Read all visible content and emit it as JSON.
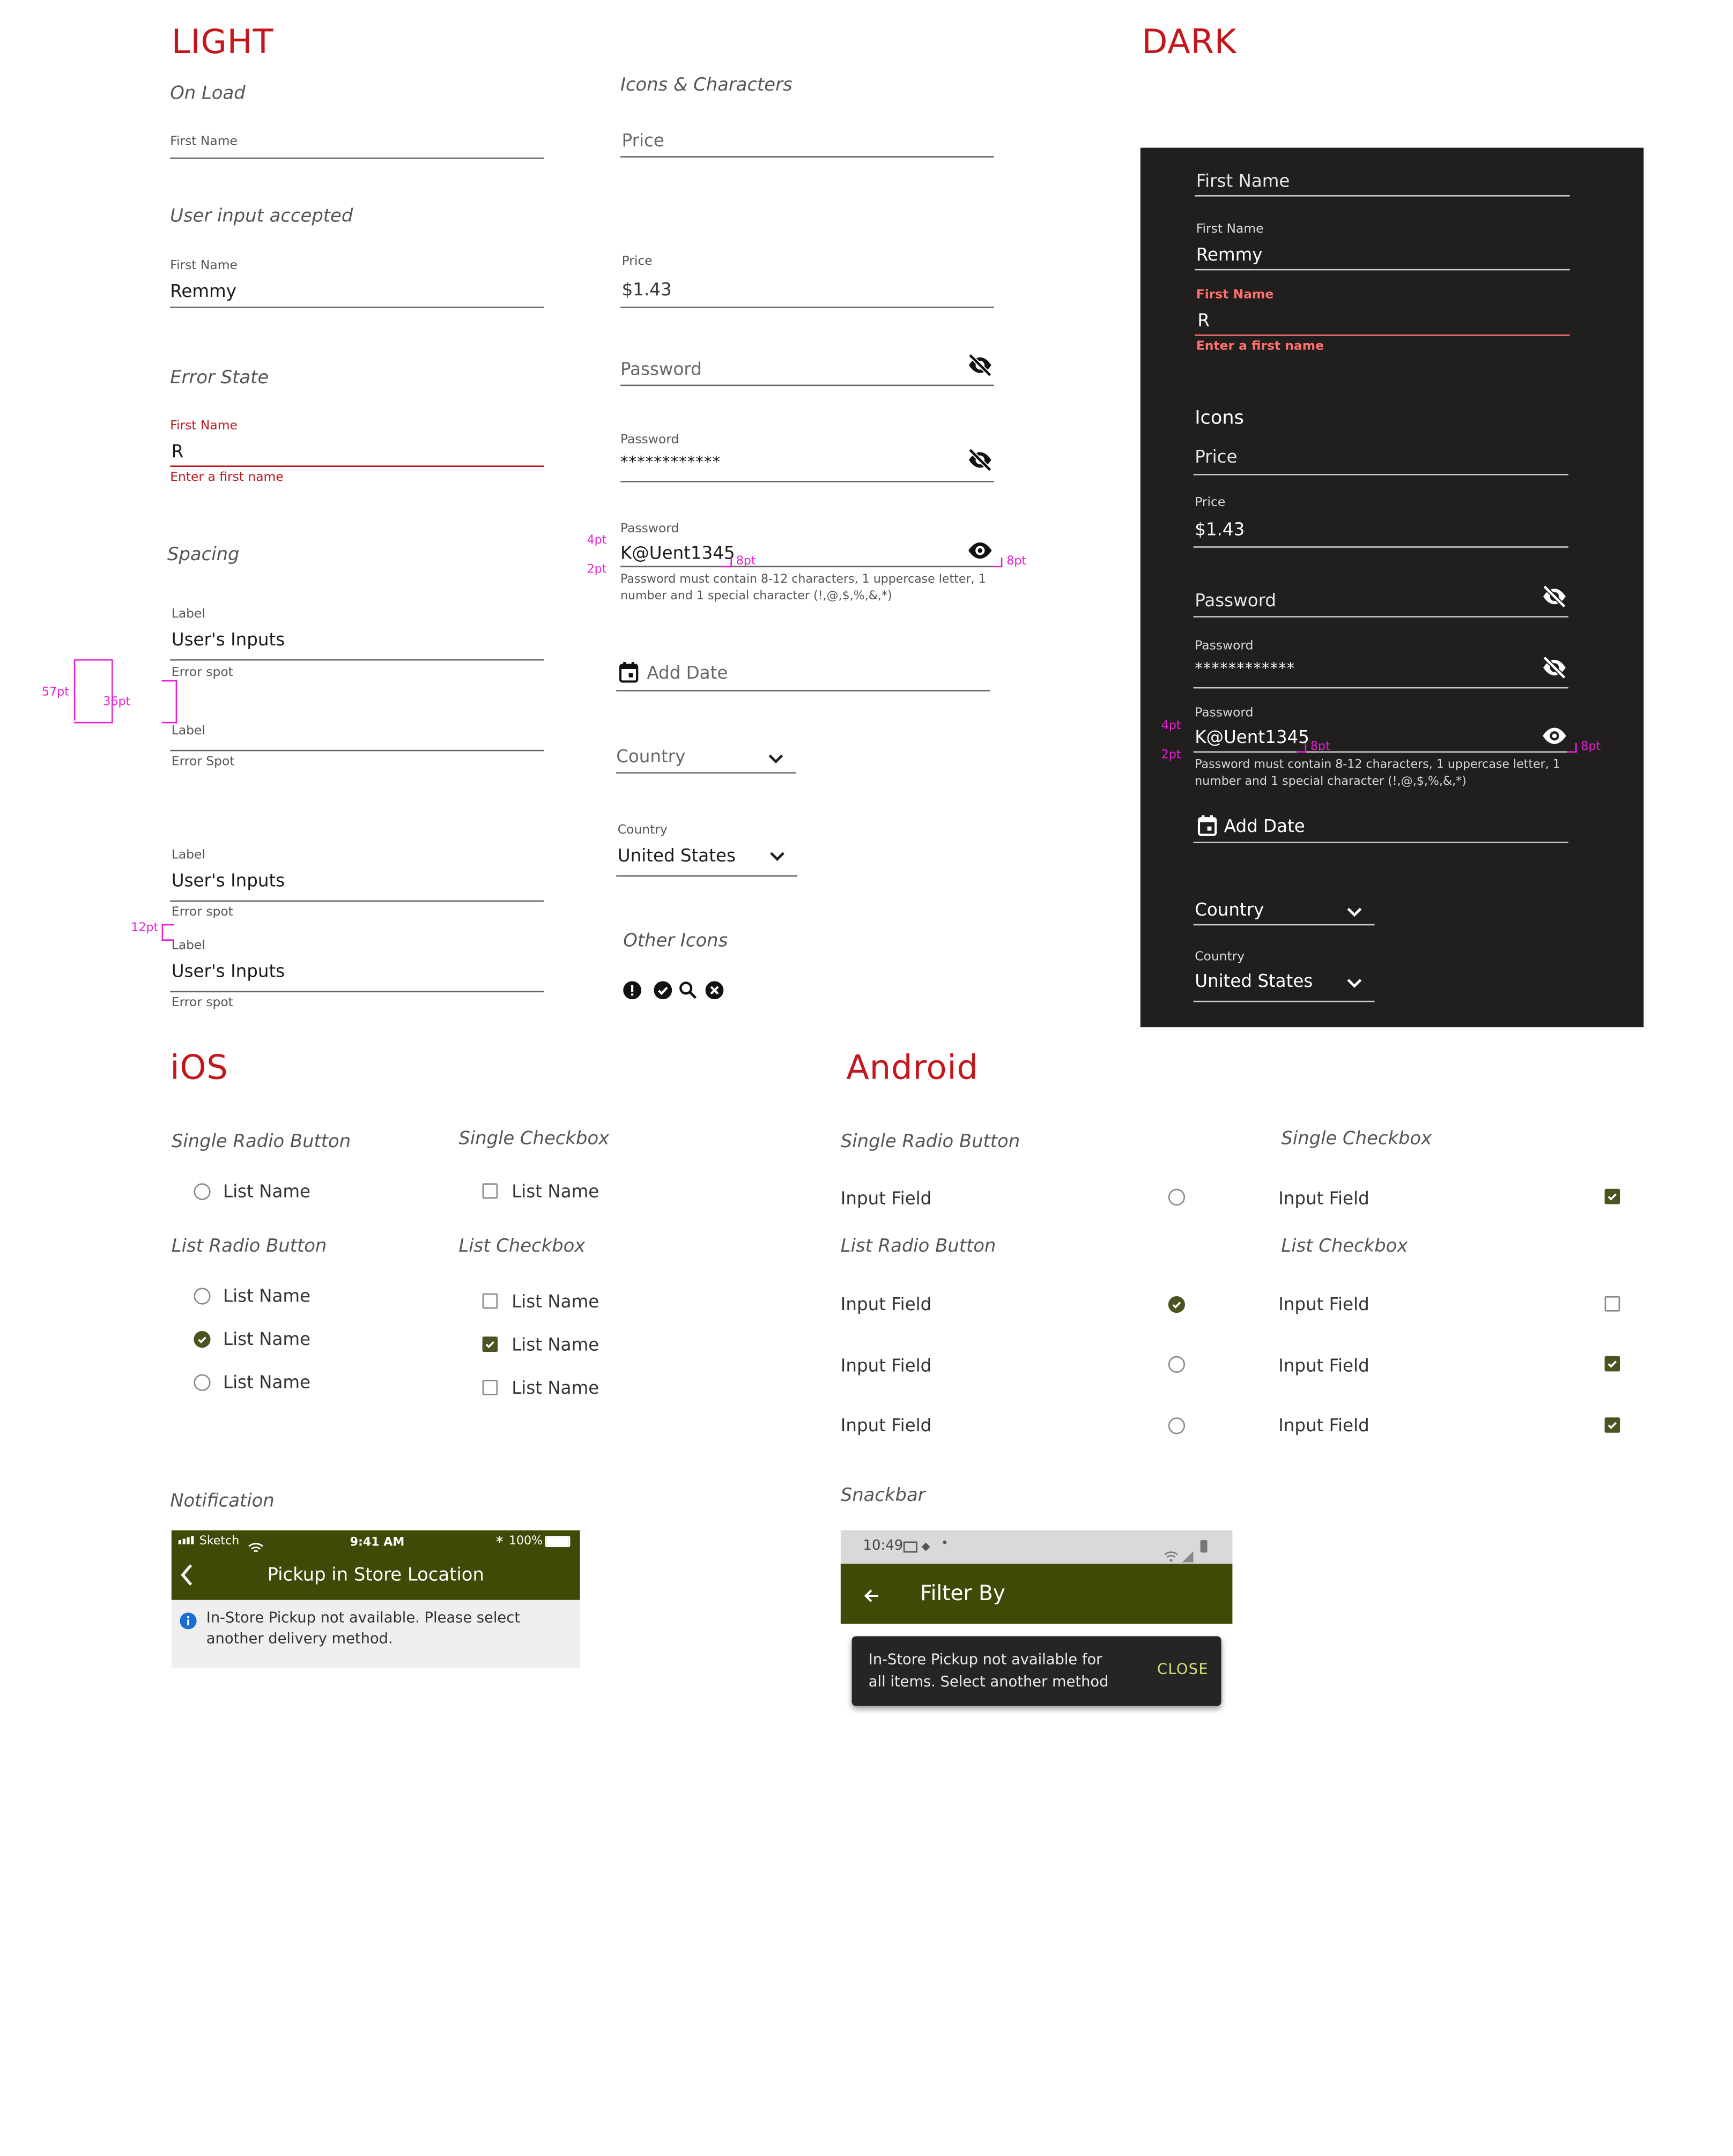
{
  "sections": {
    "light": "LIGHT",
    "dark": "DARK",
    "ios": "iOS",
    "android": "Android"
  },
  "light": {
    "on_load_title": "On Load",
    "on_load_label": "First Name",
    "accepted_title": "User input accepted",
    "accepted_label": "First Name",
    "accepted_value": "Remmy",
    "error_title": "Error State",
    "error_label": "First Name",
    "error_value": "R",
    "error_message": "Enter a first name",
    "spacing_title": "Spacing",
    "spacing": [
      {
        "label": "Label",
        "value": "User's Inputs",
        "error": "Error spot"
      },
      {
        "label": "Label",
        "value": "",
        "error": "Error Spot"
      },
      {
        "label": "Label",
        "value": "User's Inputs",
        "error": "Error spot"
      },
      {
        "label": "Label",
        "value": "User's Inputs",
        "error": "Error spot"
      }
    ],
    "annotations": {
      "a57": "57pt",
      "a36": "36pt",
      "a12": "12pt"
    },
    "icons_title": "Icons & Characters",
    "price_placeholder": "Price",
    "price_label": "Price",
    "price_value": "$1.43",
    "password_placeholder": "Password",
    "password_label": "Password",
    "password_masked": "************",
    "password_label2": "Password",
    "password_value": "K@Uent1345",
    "password_help": "Password must contain 8-12 characters, 1 uppercase letter, 1 number and 1 special character (!,@,$,%,&,*)",
    "pw_annotations": {
      "a4": "4pt",
      "a2": "2pt",
      "a8a": "8pt",
      "a8b": "8pt"
    },
    "add_date": "Add Date",
    "country_placeholder": "Country",
    "country_label": "Country",
    "country_value": "United States",
    "other_icons_title": "Other Icons"
  },
  "dark": {
    "first_name_placeholder": "First Name",
    "accepted_label": "First Name",
    "accepted_value": "Remmy",
    "error_label": "First Name",
    "error_value": "R",
    "error_message": "Enter a first name",
    "icons_title": "Icons",
    "price_placeholder": "Price",
    "price_label": "Price",
    "price_value": "$1.43",
    "password_placeholder": "Password",
    "password_label": "Password",
    "password_masked": "************",
    "password_label2": "Password",
    "password_value": "K@Uent1345",
    "password_help": "Password must contain 8-12 characters, 1 uppercase letter, 1 number and 1 special character (!,@,$,%,&,*)",
    "pw_annotations": {
      "a4": "4pt",
      "a2": "2pt",
      "a8a": "8pt",
      "a8b": "8pt"
    },
    "add_date": "Add Date",
    "country_placeholder": "Country",
    "country_label": "Country",
    "country_value": "United States"
  },
  "ios": {
    "single_radio_title": "Single Radio Button",
    "single_radio_item": "List Name",
    "single_check_title": "Single Checkbox",
    "single_check_item": "List Name",
    "list_radio_title": "List Radio Button",
    "list_radio_items": [
      "List Name",
      "List Name",
      "List Name"
    ],
    "list_check_title": "List Checkbox",
    "list_check_items": [
      "List Name",
      "List Name",
      "List Name"
    ],
    "notification_title": "Notification",
    "status_carrier": "Sketch",
    "status_time": "9:41 AM",
    "status_battery": "100%",
    "nav_title": "Pickup in Store Location",
    "notification_text": "In-Store Pickup not available. Please select another delivery method."
  },
  "android": {
    "single_radio_title": "Single Radio Button",
    "single_radio_item": "Input Field",
    "single_check_title": "Single Checkbox",
    "single_check_item": "Input Field",
    "list_radio_title": "List Radio Button",
    "list_radio_items": [
      "Input Field",
      "Input Field",
      "Input Field"
    ],
    "list_check_title": "List Checkbox",
    "list_check_items": [
      "Input Field",
      "Input Field",
      "Input Field"
    ],
    "snackbar_title": "Snackbar",
    "status_time": "10:49",
    "nav_title": "Filter By",
    "snack_text": "In-Store Pickup not available for all items. Select another method",
    "snack_action": "CLOSE"
  },
  "colors": {
    "accent_red": "#c4161c",
    "olive": "#4b5320",
    "nav_green": "#3d4b06",
    "annotation": "#e81fd4",
    "dark_bg": "#201f1d",
    "snack_action": "#d9e07a"
  },
  "icons": {
    "password_hidden": "eye-off-icon",
    "password_visible": "eye-icon",
    "date": "calendar-icon",
    "dropdown": "chevron-down-icon",
    "other": [
      "alert-icon",
      "check-circle-icon",
      "search-icon",
      "cancel-icon"
    ]
  }
}
